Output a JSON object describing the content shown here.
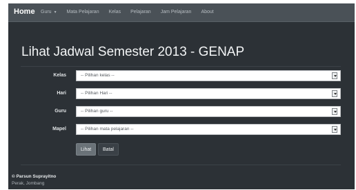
{
  "navbar": {
    "brand": "Home",
    "items": [
      {
        "label": "Guru",
        "has_dropdown": true
      },
      {
        "label": "Mata Pelajaran"
      },
      {
        "label": "Kelas"
      },
      {
        "label": "Pelajaran"
      },
      {
        "label": "Jam Pelajaran"
      },
      {
        "label": "About"
      }
    ],
    "dropdown_caret": "▼"
  },
  "page": {
    "title": "Lihat Jadwal Semester 2013 - GENAP"
  },
  "form": {
    "fields": [
      {
        "label": "Kelas",
        "selected": "-- Pilihan kelas --"
      },
      {
        "label": "Hari",
        "selected": "-- Pilihan Hari --"
      },
      {
        "label": "Guru",
        "selected": "-- Pilihan guru --"
      },
      {
        "label": "Mapel",
        "selected": "-- Pilihan mata pelajaran --"
      }
    ],
    "submit_label": "Lihat",
    "cancel_label": "Batal"
  },
  "footer": {
    "name": "© Parsun Suprayitno",
    "place": "Perak, Jombang"
  },
  "colors": {
    "background": "#2c3136",
    "navbar": "#4a5157",
    "primary_button": "#6a7278"
  }
}
